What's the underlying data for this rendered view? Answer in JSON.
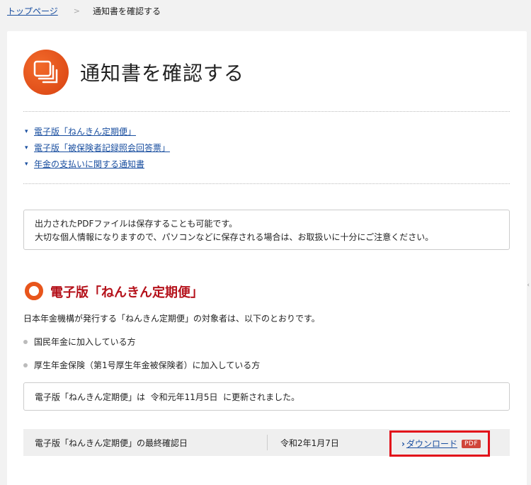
{
  "breadcrumb": {
    "home_label": "トップページ",
    "separator": ">",
    "current_label": "通知書を確認する"
  },
  "header": {
    "title": "通知書を確認する",
    "icon": "documents-icon",
    "icon_color": "#e8551b"
  },
  "anchors": [
    {
      "label": "電子版「ねんきん定期便」"
    },
    {
      "label": "電子版「被保険者記録照会回答票」"
    },
    {
      "label": "年金の支払いに関する通知書"
    }
  ],
  "notice": {
    "line1": "出力されたPDFファイルは保存することも可能です。",
    "line2": "大切な個人情報になりますので、パソコンなどに保存される場合は、お取扱いに十分にご注意ください。"
  },
  "section": {
    "title": "電子版「ねんきん定期便」",
    "title_color": "#b5121b",
    "description": "日本年金機構が発行する「ねんきん定期便」の対象者は、以下のとおりです。",
    "bullets": [
      "国民年金に加入している方",
      "厚生年金保険（第1号厚生年金被保険者）に加入している方"
    ],
    "update_notice": "電子版「ねんきん定期便」は  令和元年11月5日  に更新されました。",
    "last_check_label": "電子版「ねんきん定期便」の最終確認日",
    "last_check_date": "令和2年1月7日",
    "download_label": "ダウンロード",
    "download_badge": "PDF",
    "highlight_color": "#e2101a"
  }
}
